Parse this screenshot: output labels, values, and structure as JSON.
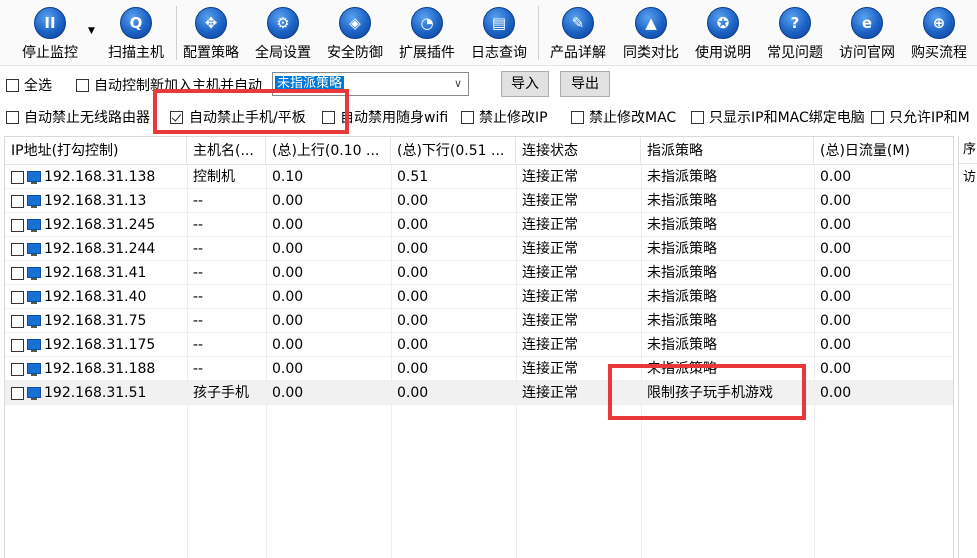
{
  "toolbar": {
    "buttons": [
      {
        "label": "停止监控",
        "icon": "pause-icon"
      },
      {
        "label": "扫描主机",
        "icon": "search-icon"
      },
      {
        "label": "配置策略",
        "icon": "move-icon"
      },
      {
        "label": "全局设置",
        "icon": "gear-icon"
      },
      {
        "label": "安全防御",
        "icon": "shield-icon"
      },
      {
        "label": "扩展插件",
        "icon": "pie-chart-icon"
      },
      {
        "label": "日志查询",
        "icon": "log-icon"
      },
      {
        "label": "产品详解",
        "icon": "edit-icon"
      },
      {
        "label": "同类对比",
        "icon": "graduation-cap-icon"
      },
      {
        "label": "使用说明",
        "icon": "award-icon"
      },
      {
        "label": "常见问题",
        "icon": "question-icon"
      },
      {
        "label": "访问官网",
        "icon": "ie-browser-icon"
      },
      {
        "label": "购买流程",
        "icon": "cart-icon"
      }
    ],
    "glyphs": [
      "II",
      "Q",
      "✥",
      "⚙",
      "◈",
      "◔",
      "▤",
      "✎",
      "▲",
      "✪",
      "?",
      "e",
      "⊕"
    ],
    "dropdown_glyph": "▼"
  },
  "row2": {
    "select_all_label": "全选",
    "auto_control_label": "自动控制新加入主机并自动",
    "policy_select_value": "未指派策略",
    "import_label": "导入",
    "export_label": "导出"
  },
  "row3": {
    "options": [
      {
        "label": "自动禁止无线路由器",
        "checked": false
      },
      {
        "label": "自动禁止手机/平板",
        "checked": true
      },
      {
        "label": "自动禁用随身wifi",
        "checked": false
      },
      {
        "label": "禁止修改IP",
        "checked": false
      },
      {
        "label": "禁止修改MAC",
        "checked": false
      },
      {
        "label": "只显示IP和MAC绑定电脑",
        "checked": false
      },
      {
        "label": "只允许IP和M",
        "checked": false
      }
    ]
  },
  "table": {
    "columns": [
      "IP地址(打勾控制)",
      "主机名(...",
      "(总)上行(0.10 ...",
      "(总)下行(0.51 ...",
      "连接状态",
      "指派策略",
      "(总)日流量(M)"
    ],
    "rows": [
      {
        "ip": "192.168.31.138",
        "host": "控制机",
        "up": "0.10",
        "down": "0.51",
        "status": "连接正常",
        "policy": "未指派策略",
        "daily": "0.00"
      },
      {
        "ip": "192.168.31.13",
        "host": "--",
        "up": "0.00",
        "down": "0.00",
        "status": "连接正常",
        "policy": "未指派策略",
        "daily": "0.00"
      },
      {
        "ip": "192.168.31.245",
        "host": "--",
        "up": "0.00",
        "down": "0.00",
        "status": "连接正常",
        "policy": "未指派策略",
        "daily": "0.00"
      },
      {
        "ip": "192.168.31.244",
        "host": "--",
        "up": "0.00",
        "down": "0.00",
        "status": "连接正常",
        "policy": "未指派策略",
        "daily": "0.00"
      },
      {
        "ip": "192.168.31.41",
        "host": "--",
        "up": "0.00",
        "down": "0.00",
        "status": "连接正常",
        "policy": "未指派策略",
        "daily": "0.00"
      },
      {
        "ip": "192.168.31.40",
        "host": "--",
        "up": "0.00",
        "down": "0.00",
        "status": "连接正常",
        "policy": "未指派策略",
        "daily": "0.00"
      },
      {
        "ip": "192.168.31.75",
        "host": "--",
        "up": "0.00",
        "down": "0.00",
        "status": "连接正常",
        "policy": "未指派策略",
        "daily": "0.00"
      },
      {
        "ip": "192.168.31.175",
        "host": "--",
        "up": "0.00",
        "down": "0.00",
        "status": "连接正常",
        "policy": "未指派策略",
        "daily": "0.00"
      },
      {
        "ip": "192.168.31.188",
        "host": "--",
        "up": "0.00",
        "down": "0.00",
        "status": "连接正常",
        "policy": "未指派策略",
        "daily": "0.00"
      },
      {
        "ip": "192.168.31.51",
        "host": "孩子手机",
        "up": "0.00",
        "down": "0.00",
        "status": "连接正常",
        "policy": "限制孩子玩手机游戏",
        "daily": "0.00"
      }
    ],
    "selected_row": 9
  },
  "side_panel": {
    "header": "序",
    "text": "访"
  },
  "colors": {
    "accent": "#0078d7",
    "annotation_red": "#e8383a",
    "pc_icon": "#1a6fd4"
  }
}
